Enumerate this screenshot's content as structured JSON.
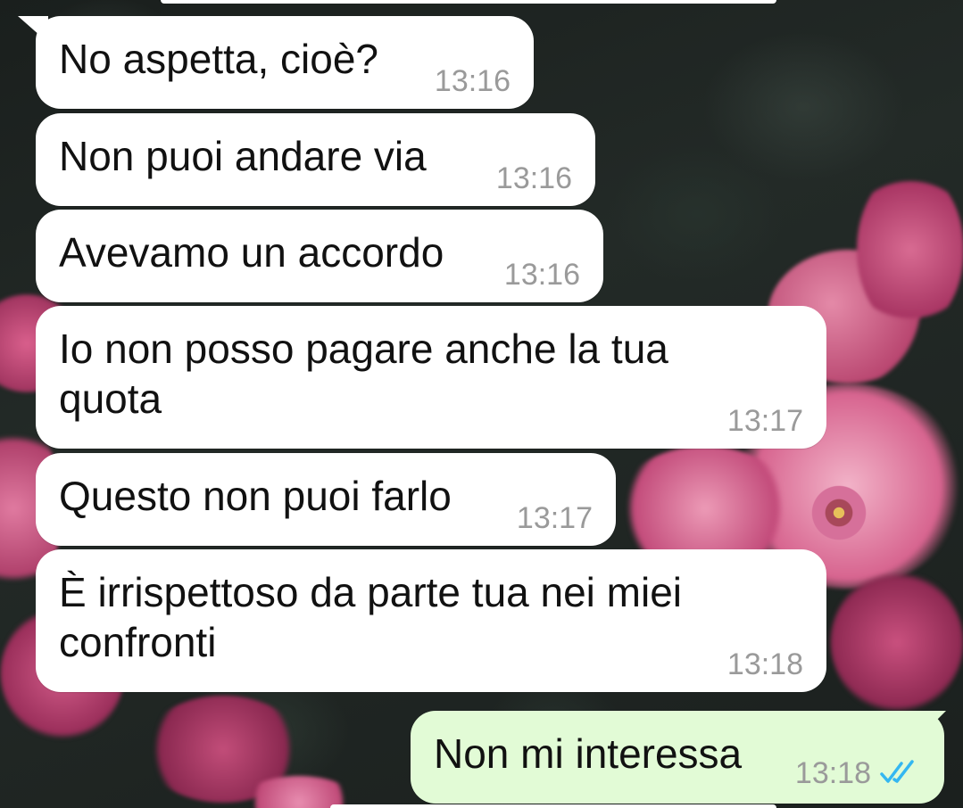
{
  "colors": {
    "incoming_bubble": "#ffffff",
    "outgoing_bubble": "#e2fbd6",
    "timestamp": "#9a9a9a",
    "read_ticks": "#34b7f1",
    "text": "#111111"
  },
  "wallpaper": {
    "icon": "pink-roses-wallpaper"
  },
  "messages": [
    {
      "direction": "in",
      "text": "No aspetta, cioè?",
      "time": "13:16"
    },
    {
      "direction": "in",
      "text": "Non puoi andare via",
      "time": "13:16"
    },
    {
      "direction": "in",
      "text": "Avevamo un accordo",
      "time": "13:16"
    },
    {
      "direction": "in",
      "text": "Io non posso pagare anche la tua quota",
      "time": "13:17"
    },
    {
      "direction": "in",
      "text": "Questo non puoi farlo",
      "time": "13:17"
    },
    {
      "direction": "in",
      "text": "È irrispettoso da parte tua nei miei confronti",
      "time": "13:18"
    },
    {
      "direction": "out",
      "text": "Non mi interessa",
      "time": "13:18",
      "status_icon": "double-check-read-icon"
    }
  ]
}
